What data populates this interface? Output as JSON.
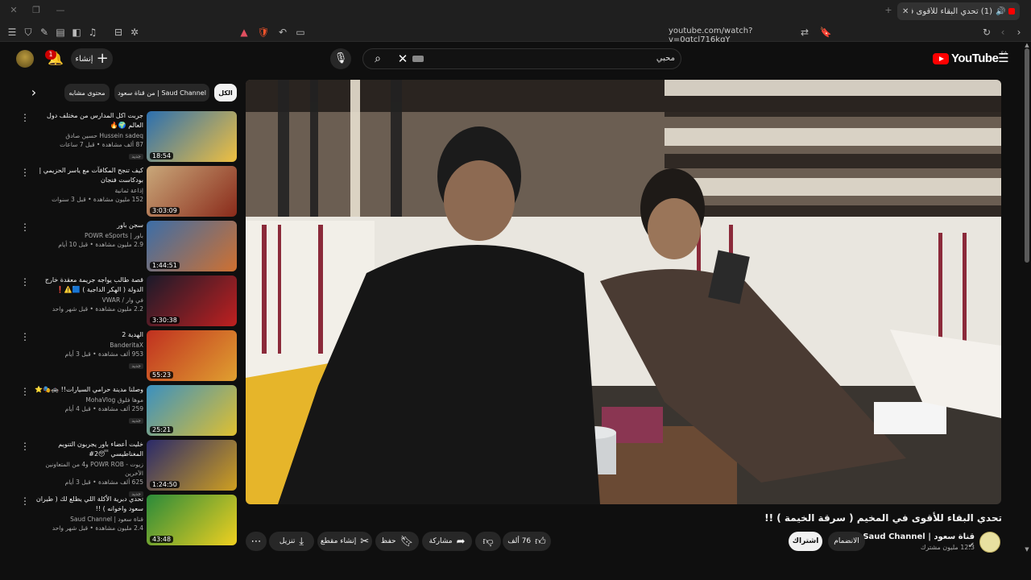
{
  "browser": {
    "tab_title": "(1) تحدي البقاء للأقوى في المخ",
    "url": "youtube.com/watch?v=0qtcl716kqY"
  },
  "header": {
    "create_label": "إنشاء",
    "notification_count": "1",
    "search_value": "محبي",
    "logo_text": "YouTube",
    "logo_country": "SA"
  },
  "chips": [
    {
      "label": "الكل"
    },
    {
      "label": "من قناة سعود | Saud Channel"
    },
    {
      "label": "محتوى مشابه"
    }
  ],
  "recommendations": [
    {
      "title": "جربت اكل المدارس من مختلف دول العالم 🌍🔥",
      "channel": "Hussein sadeq حسين صادق",
      "views": "87 ألف مشاهدة • قبل 7 ساعات",
      "tag": "جديد",
      "duration": "18:54"
    },
    {
      "title": "كيف تنجح المكافآت مع ياسر الحزيمي | بودكاست فنجان",
      "channel": "إذاعة ثمانية",
      "views": "152 مليون مشاهدة • قبل 3 سنوات",
      "tag": "",
      "duration": "3:03:09"
    },
    {
      "title": "سجن باور",
      "channel": "باور | POWR eSports",
      "views": "2.9 مليون مشاهدة • قبل 10 أيام",
      "tag": "",
      "duration": "1:44:51"
    },
    {
      "title": "قصة طالب يواجه جريمة معقدة خارج الدولة ( الهكر الداجية ) 🟦⚠️❗",
      "channel": "في وار / VWAR",
      "views": "2.2 مليون مشاهدة • قبل شهر واحد",
      "tag": "",
      "duration": "3:30:38"
    },
    {
      "title": "الهدية 2",
      "channel": "BanderitaX",
      "views": "953 ألف مشاهدة • قبل 3 أيام",
      "tag": "جديد",
      "duration": "55:23"
    },
    {
      "title": "وصلنا مدينة حرامي السيارات!! 🚓🎭⭐",
      "channel": "موها فلوق MohaVlog",
      "views": "259 ألف مشاهدة • قبل 4 أيام",
      "tag": "جديد",
      "duration": "25:21"
    },
    {
      "title": "خليت أعضاء باور يجربون التنويم المغناطيسي 😴2#",
      "channel": "زيوت - POWR ROB و4 من المتعاونين الآخرين",
      "views": "625 ألف مشاهدة • قبل 3 أيام",
      "tag": "جديد",
      "duration": "1:24:50"
    },
    {
      "title": "تحدي دبرية الأكلة اللي يطلع لك ( طيران سعود واخوانه ) !!",
      "channel": "قناة سعود | Saud Channel",
      "views": "2.4 مليون مشاهدة • قبل شهر واحد",
      "tag": "",
      "duration": "43:48"
    }
  ],
  "video": {
    "title": "تحدي البقاء للأقوى في المخيم ( سرقة الخيمة ) !!",
    "channel_name": "قناة سعود | Saud Channel",
    "subscribers": "12.3 مليون مشترك",
    "join_label": "الانضمام",
    "subscribe_label": "اشتراك",
    "likes": "76 ألف",
    "share_label": "مشاركة",
    "save_label": "حفظ",
    "clip_label": "إنشاء مقطع",
    "download_label": "تنزيل"
  }
}
